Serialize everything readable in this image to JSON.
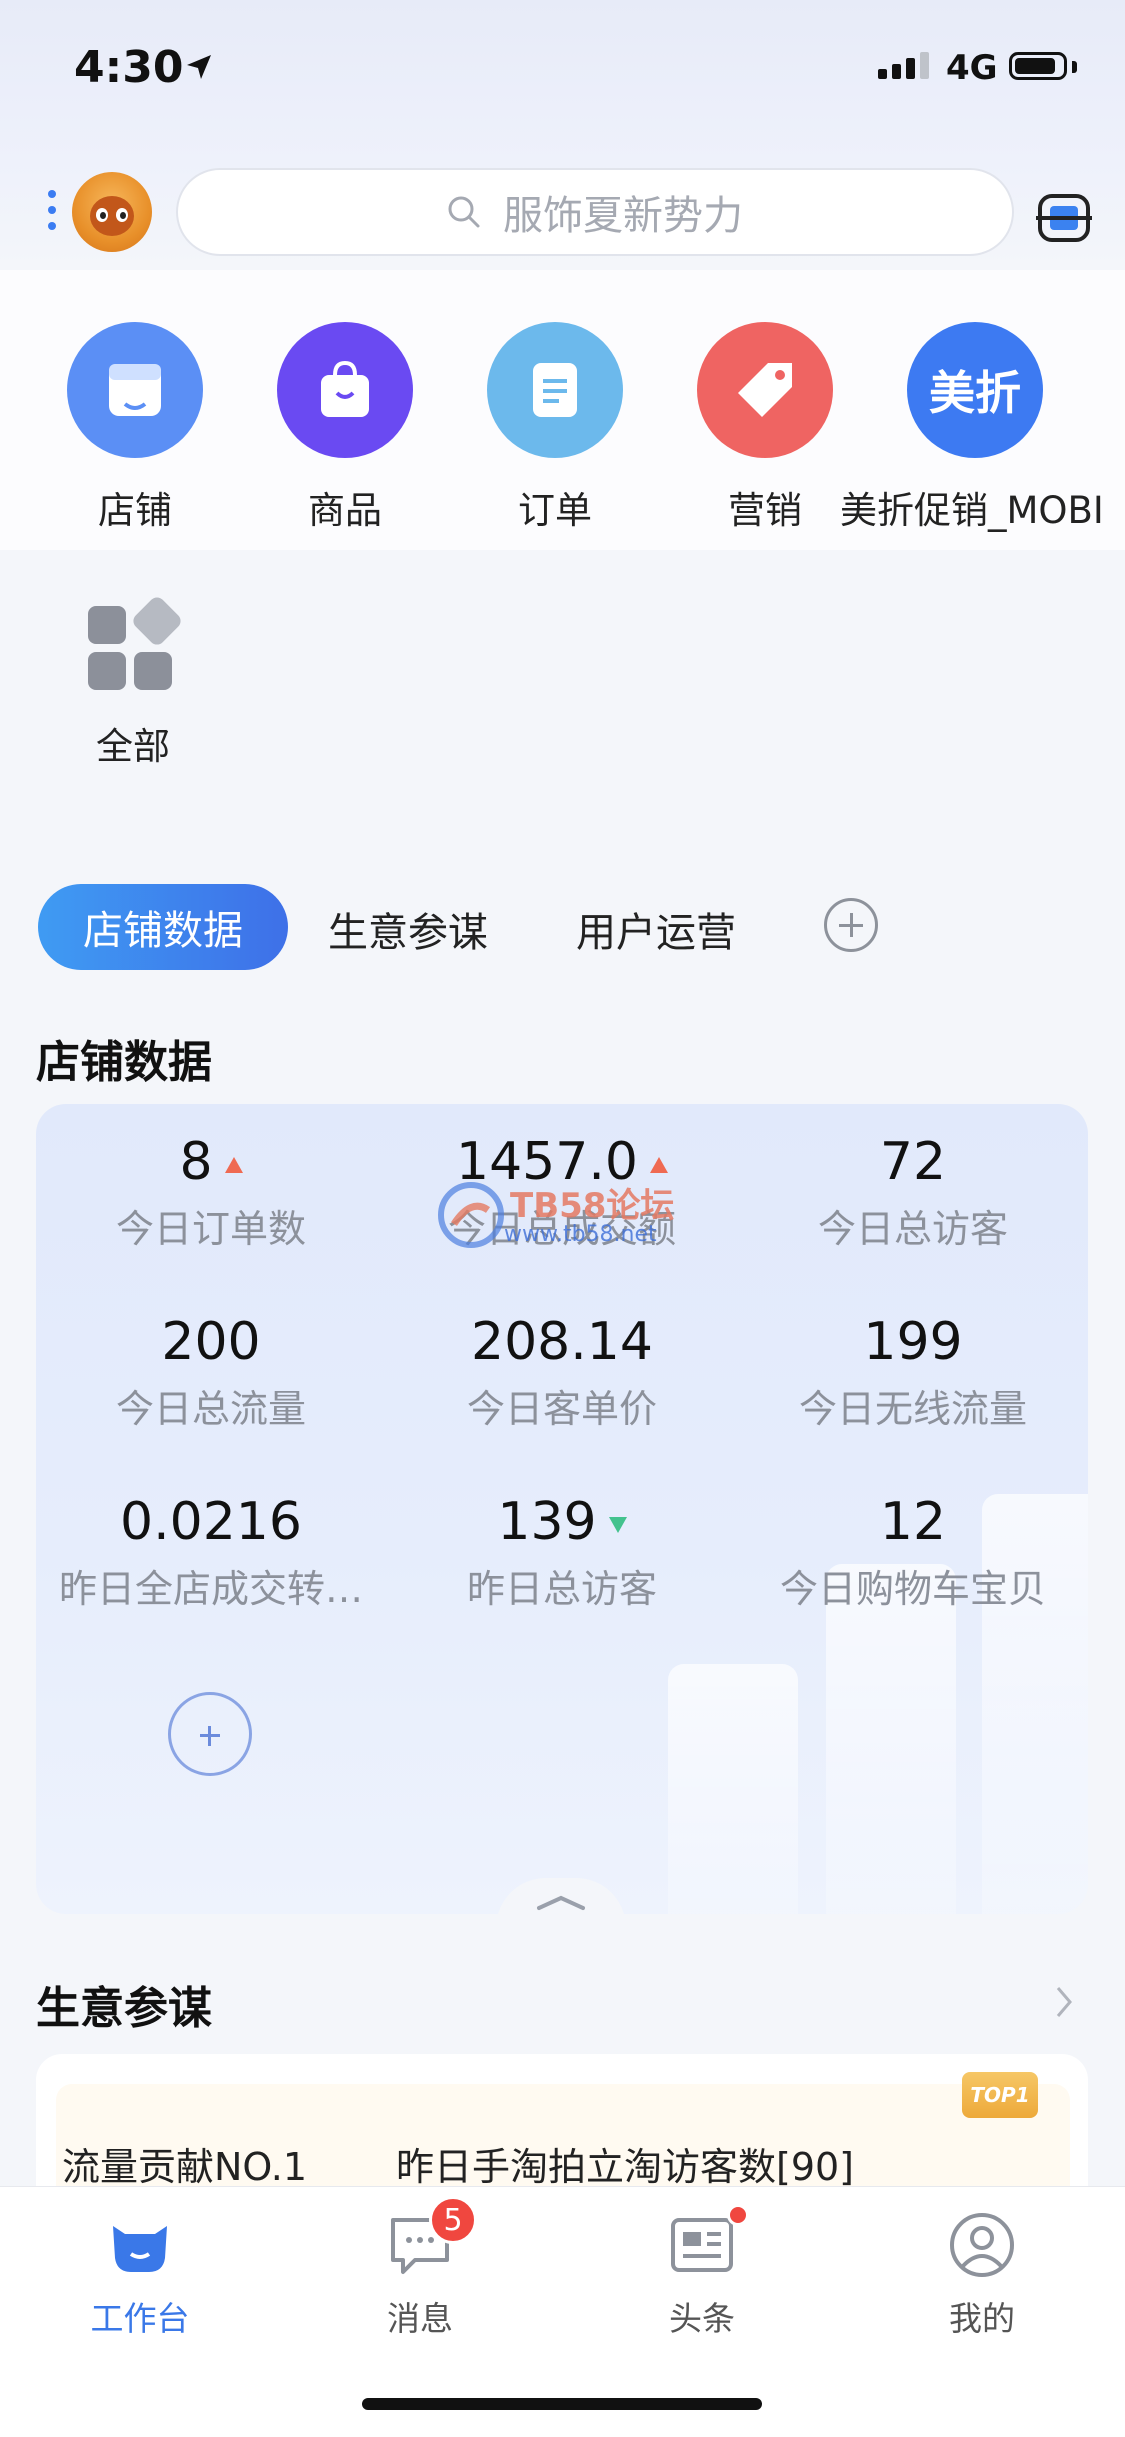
{
  "status_bar": {
    "time": "4:30",
    "network": "4G"
  },
  "header": {
    "search_placeholder": "服饰夏新势力"
  },
  "quick_nav": {
    "items": [
      {
        "label": "店铺",
        "color": "#5b8ff5"
      },
      {
        "label": "商品",
        "color": "#6a4af2"
      },
      {
        "label": "订单",
        "color": "#6cb9ec"
      },
      {
        "label": "营销",
        "color": "#ef6462"
      },
      {
        "label": "美折促销_MOBI",
        "color": "#3d7af2",
        "icon_text": "美折"
      }
    ],
    "all_label": "全部"
  },
  "tabs": {
    "active": "店铺数据",
    "items": [
      "生意参谋",
      "用户运营"
    ]
  },
  "store_data": {
    "title": "店铺数据",
    "metrics": [
      {
        "value": "8",
        "label": "今日订单数",
        "trend": "up"
      },
      {
        "value": "1457.0",
        "label": "今日总成交额",
        "trend": "up"
      },
      {
        "value": "72",
        "label": "今日总访客",
        "trend": ""
      },
      {
        "value": "200",
        "label": "今日总流量",
        "trend": ""
      },
      {
        "value": "208.14",
        "label": "今日客单价",
        "trend": ""
      },
      {
        "value": "199",
        "label": "今日无线流量",
        "trend": ""
      },
      {
        "value": "0.0216",
        "label": "昨日全店成交转…",
        "trend": ""
      },
      {
        "value": "139",
        "label": "昨日总访客",
        "trend": "down"
      },
      {
        "value": "12",
        "label": "今日购物车宝贝",
        "trend": ""
      }
    ],
    "watermark": {
      "line1": "TB58论坛",
      "line2": "www.tb58.net"
    }
  },
  "business": {
    "title": "生意参谋",
    "card": {
      "tag": "TOP1",
      "left": "流量贡献NO.1",
      "right": "昨日手淘拍立淘访客数[90]"
    }
  },
  "tab_bar": {
    "items": [
      {
        "label": "工作台",
        "active": true
      },
      {
        "label": "消息",
        "badge": "5"
      },
      {
        "label": "头条",
        "dot": true
      },
      {
        "label": "我的"
      }
    ],
    "active_color": "#3a78e8"
  }
}
